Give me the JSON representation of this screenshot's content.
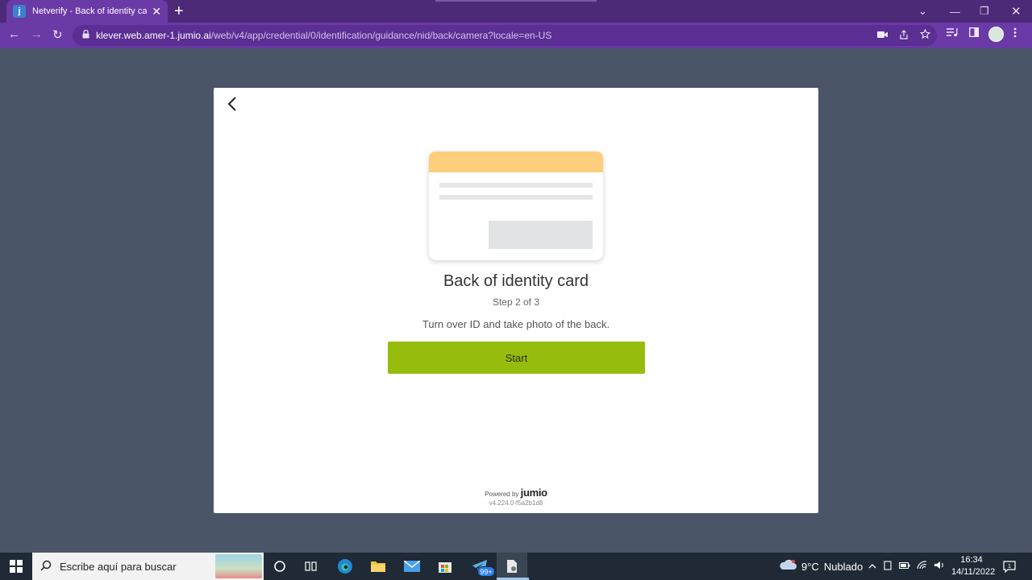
{
  "browser": {
    "tab": {
      "favicon": "j",
      "title": "Netverify - Back of identity card",
      "close": "✕"
    },
    "new_tab": "+",
    "window": {
      "tab_search": "⌄",
      "minimize": "—",
      "maximize": "❐",
      "close": "✕"
    },
    "nav": {
      "back": "←",
      "forward": "→",
      "reload": "↻"
    },
    "url_host": "klever.web.amer-1.jumio.ai",
    "url_path": "/web/v4/app/credential/0/identification/guidance/nid/back/camera?locale=en-US",
    "icons": [
      "camera-icon",
      "share-icon",
      "star-icon",
      "media-icon",
      "side-panel-icon",
      "avatar",
      "menu-icon"
    ]
  },
  "card": {
    "title": "Back of identity card",
    "step": "Step 2 of 3",
    "instruction": "Turn over ID and take photo of the back.",
    "start_label": "Start",
    "powered_by": "Powered by",
    "brand": "jumio",
    "version": "v4.224.0-f5a2b1d8",
    "colors": {
      "button": "#96bd0d",
      "card_header": "#fdcf7d"
    }
  },
  "taskbar": {
    "search_placeholder": "Escribe aquí para buscar",
    "badge": "99+",
    "weather": {
      "temp": "9°C",
      "condition": "Nublado"
    },
    "time": "16:34",
    "date": "14/11/2022",
    "notifications": "1"
  }
}
